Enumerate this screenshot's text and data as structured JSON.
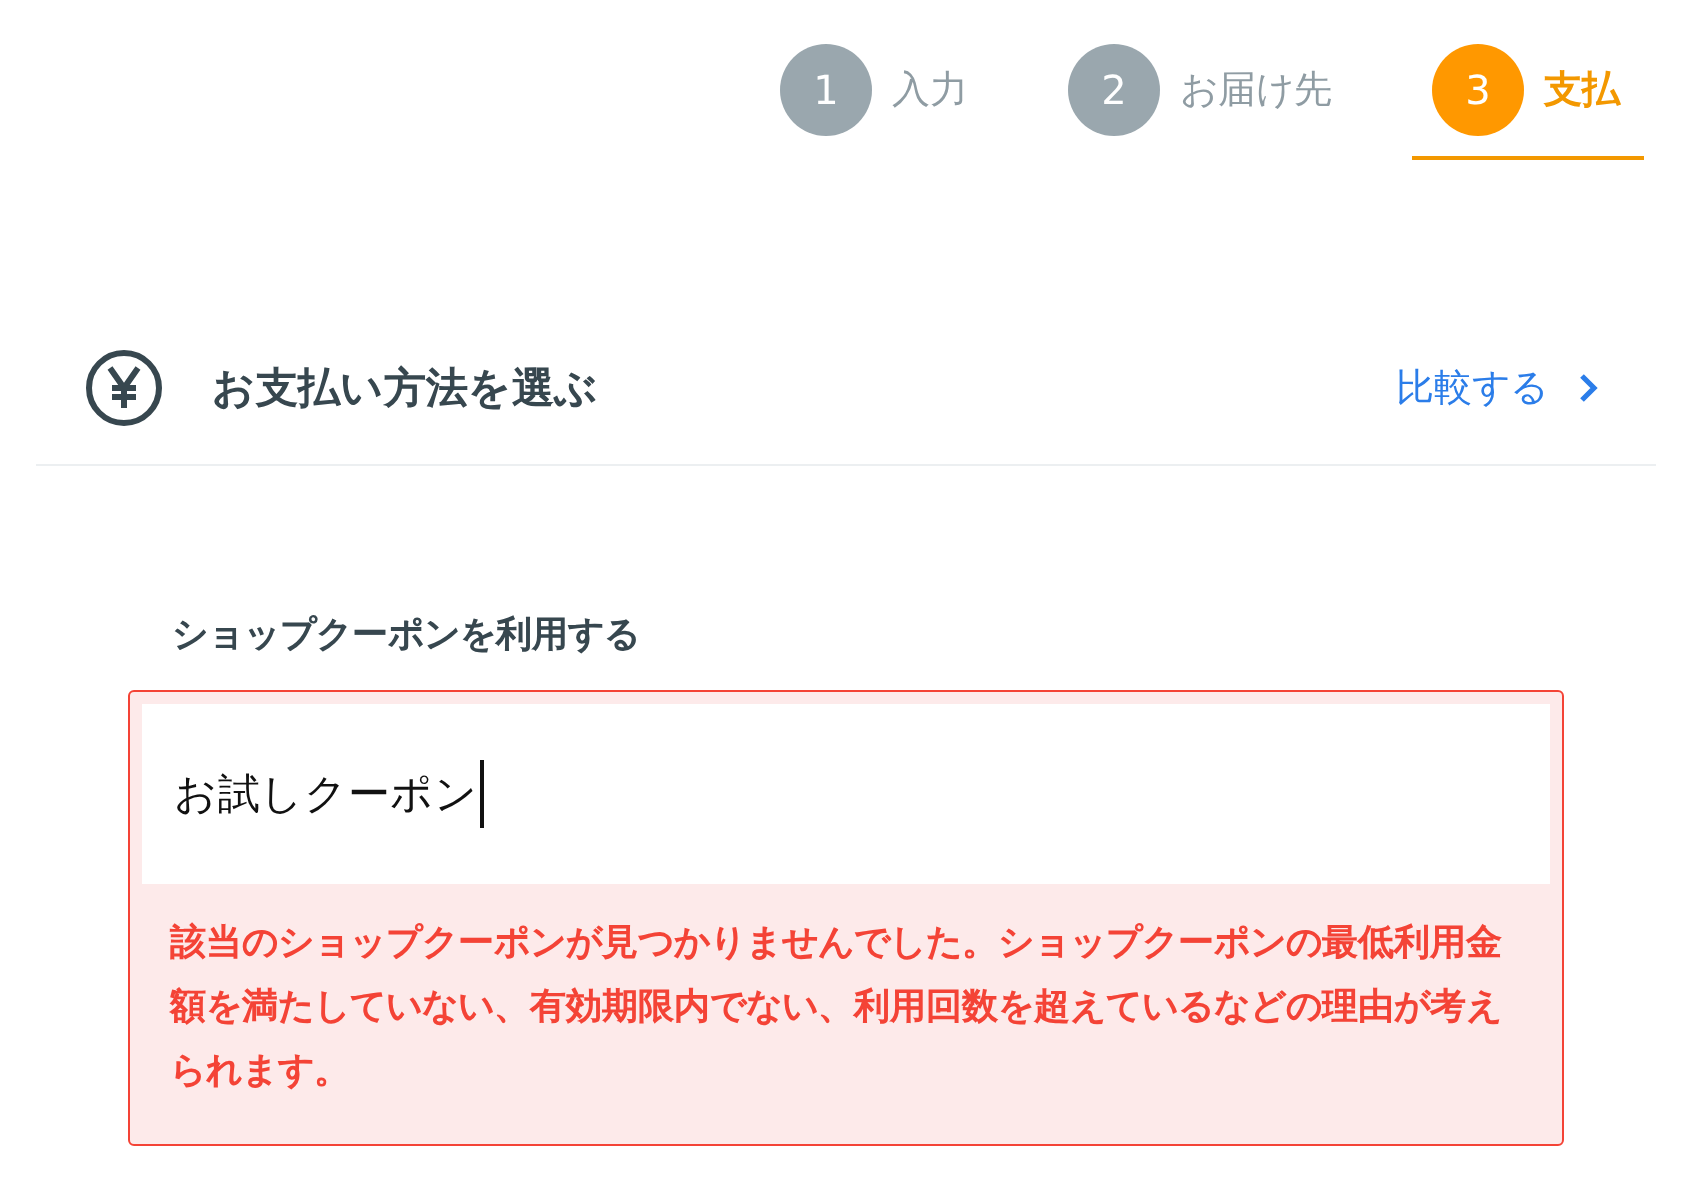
{
  "steps": [
    {
      "number": "1",
      "label": "入力",
      "selected": false
    },
    {
      "number": "2",
      "label": "お届け先",
      "selected": false
    },
    {
      "number": "3",
      "label": "支払",
      "selected": true
    }
  ],
  "section": {
    "title": "お支払い方法を選ぶ",
    "link": "比較する"
  },
  "coupon": {
    "label": "ショップクーポンを利用する",
    "value": "お試しクーポン",
    "error": "該当のショップクーポンが見つかりませんでした。ショップクーポンの最低利用金額を満たしていない、有効期限内でない、利用回数を超えているなどの理由が考えられます。"
  }
}
